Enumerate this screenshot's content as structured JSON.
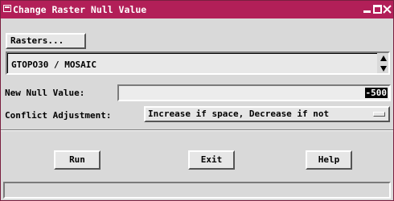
{
  "window": {
    "title": "Change Raster Null Value",
    "title_icon": "window-menu-icon",
    "controls": [
      "minimize-icon",
      "maximize-icon",
      "close-icon"
    ],
    "accent_color": "#b21f58"
  },
  "rasters": {
    "button_label": "Rasters...",
    "items": [
      "GTOPO30 / MOSAIC"
    ]
  },
  "null_value": {
    "label": "New Null Value:",
    "value": "-500"
  },
  "conflict": {
    "label": "Conflict Adjustment:",
    "selected": "Increase if space, Decrease if not"
  },
  "actions": {
    "run": "Run",
    "exit": "Exit",
    "help": "Help"
  },
  "status": {
    "text": ""
  }
}
